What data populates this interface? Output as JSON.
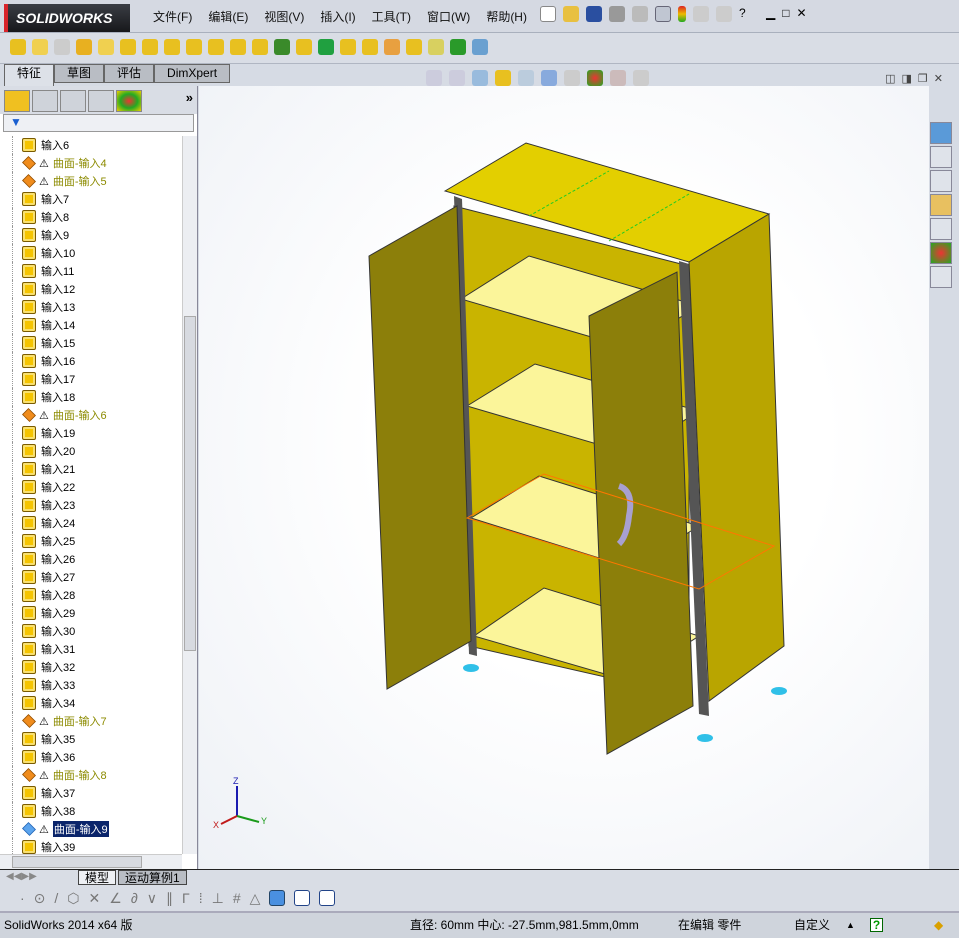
{
  "app": {
    "logo": "SOLIDWORKS"
  },
  "menu": [
    "文件(F)",
    "编辑(E)",
    "视图(V)",
    "插入(I)",
    "工具(T)",
    "窗口(W)",
    "帮助(H)"
  ],
  "tabs": [
    "特征",
    "草图",
    "评估",
    "DimXpert"
  ],
  "tree": [
    {
      "label": "输入6",
      "type": "feature"
    },
    {
      "label": "曲面-输入4",
      "type": "surface",
      "warning": true
    },
    {
      "label": "曲面-输入5",
      "type": "surface",
      "warning": true
    },
    {
      "label": "输入7",
      "type": "feature"
    },
    {
      "label": "输入8",
      "type": "feature"
    },
    {
      "label": "输入9",
      "type": "feature"
    },
    {
      "label": "输入10",
      "type": "feature"
    },
    {
      "label": "输入11",
      "type": "feature"
    },
    {
      "label": "输入12",
      "type": "feature"
    },
    {
      "label": "输入13",
      "type": "feature"
    },
    {
      "label": "输入14",
      "type": "feature"
    },
    {
      "label": "输入15",
      "type": "feature"
    },
    {
      "label": "输入16",
      "type": "feature"
    },
    {
      "label": "输入17",
      "type": "feature"
    },
    {
      "label": "输入18",
      "type": "feature"
    },
    {
      "label": "曲面-输入6",
      "type": "surface",
      "warning": true
    },
    {
      "label": "输入19",
      "type": "feature"
    },
    {
      "label": "输入20",
      "type": "feature"
    },
    {
      "label": "输入21",
      "type": "feature"
    },
    {
      "label": "输入22",
      "type": "feature"
    },
    {
      "label": "输入23",
      "type": "feature"
    },
    {
      "label": "输入24",
      "type": "feature"
    },
    {
      "label": "输入25",
      "type": "feature"
    },
    {
      "label": "输入26",
      "type": "feature"
    },
    {
      "label": "输入27",
      "type": "feature"
    },
    {
      "label": "输入28",
      "type": "feature"
    },
    {
      "label": "输入29",
      "type": "feature"
    },
    {
      "label": "输入30",
      "type": "feature"
    },
    {
      "label": "输入31",
      "type": "feature"
    },
    {
      "label": "输入32",
      "type": "feature"
    },
    {
      "label": "输入33",
      "type": "feature"
    },
    {
      "label": "输入34",
      "type": "feature"
    },
    {
      "label": "曲面-输入7",
      "type": "surface",
      "warning": true
    },
    {
      "label": "输入35",
      "type": "feature"
    },
    {
      "label": "输入36",
      "type": "feature"
    },
    {
      "label": "曲面-输入8",
      "type": "surface",
      "warning": true
    },
    {
      "label": "输入37",
      "type": "feature"
    },
    {
      "label": "输入38",
      "type": "feature"
    },
    {
      "label": "曲面-输入9",
      "type": "surface",
      "warning": true,
      "selected": true
    },
    {
      "label": "输入39",
      "type": "feature"
    }
  ],
  "bottom_tabs": [
    "模型",
    "运动算例1"
  ],
  "triad": {
    "x": "X",
    "y": "Y",
    "z": "Z"
  },
  "status": {
    "version": "SolidWorks 2014 x64 版",
    "measure": "直径: 60mm  中心: -27.5mm,981.5mm,0mm",
    "mode": "在编辑 零件",
    "custom": "自定义"
  },
  "colors": {
    "model": "#e3cf00",
    "door": "#8c7f0a",
    "shelf": "#fbf59a",
    "frame": "#3a3a3a",
    "selection": "#ff7700"
  }
}
